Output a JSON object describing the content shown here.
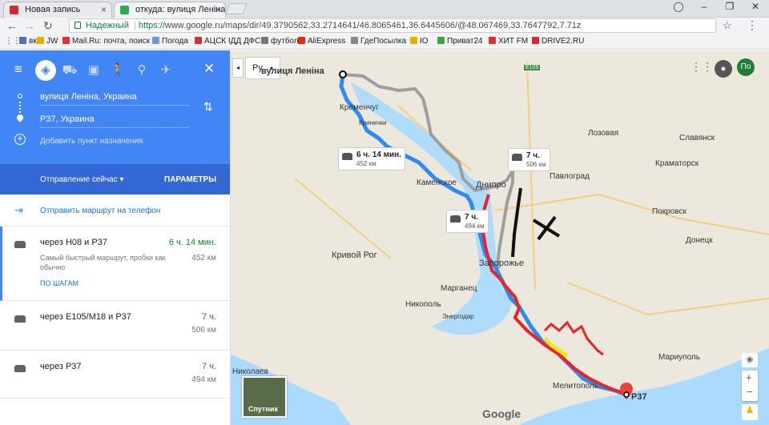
{
  "browser": {
    "tabs": [
      {
        "title": "Новая запись",
        "favicon_color": "#d62b2b"
      },
      {
        "title": "откуда: вулиця Леніна, Э",
        "favicon_color": "#34a853"
      }
    ],
    "url_secure_label": "Надежный",
    "url_scheme": "https://",
    "url_rest": "www.google.ru/maps/dir/49.3790562,33.2714641/46.8065461,36.6445606/@48.067469,33.7647792,7.71z",
    "bookmarks": [
      {
        "label": "вк",
        "color": "#4a76a8"
      },
      {
        "label": "JW",
        "color": "#e0b300"
      },
      {
        "label": "Mail.Ru: почта, поиск",
        "color": "#d33"
      },
      {
        "label": "Погода",
        "color": "#6b9bd1"
      },
      {
        "label": "АЦСК ІДД ДФС",
        "color": "#c33"
      },
      {
        "label": "футбол",
        "color": "#777"
      },
      {
        "label": "AliExpress",
        "color": "#e62e04"
      },
      {
        "label": "ГдеПосылка",
        "color": "#888"
      },
      {
        "label": "IO",
        "color": "#e0b300"
      },
      {
        "label": "Приват24",
        "color": "#46a046"
      },
      {
        "label": "ХИТ FM",
        "color": "#d33"
      },
      {
        "label": "DRIVE2.RU",
        "color": "#d62b2b"
      }
    ]
  },
  "panel": {
    "waypoint_from": "вулиця Леніна, Украина",
    "waypoint_to": "P37, Украина",
    "add_destination": "Добавить пункт назначения",
    "depart": "Отправление сейчас",
    "params": "ПАРАМЕТРЫ",
    "send_to_phone": "Отправить маршрут на телефон",
    "routes": [
      {
        "title": "через H08 и P37",
        "duration": "6 ч. 14 мин.",
        "distance": "452 км",
        "desc": "Самый быстрый маршрут, пробки как обычно",
        "steps": "ПО ШАГАМ"
      },
      {
        "title": "через E105/M18 и P37",
        "duration": "7 ч.",
        "distance": "506 км"
      },
      {
        "title": "через P37",
        "duration": "7 ч.",
        "distance": "494 км"
      }
    ]
  },
  "map": {
    "lang": "Ру",
    "avatar": "По",
    "satellite": "Спутник",
    "google": "Google",
    "origin_label": "вулиця Леніна",
    "dest_label": "P37",
    "road_label": "E105",
    "route_boxes": [
      {
        "dur": "6 ч. 14 мин.",
        "dist": "452 км"
      },
      {
        "dur": "7 ч.",
        "dist": "506 км"
      },
      {
        "dur": "7 ч.",
        "dist": "494 км"
      }
    ],
    "places": [
      "Кременчуг",
      "Кринички",
      "Каменское",
      "Днипро",
      "Павлоград",
      "Славянск",
      "Краматорск",
      "Лозовая",
      "Покровск",
      "Донецк",
      "Кривой Рог",
      "Запорожье",
      "Марганец",
      "Никополь",
      "Энергодар",
      "Мелитополь",
      "Мариуполь",
      "Николаев"
    ]
  }
}
